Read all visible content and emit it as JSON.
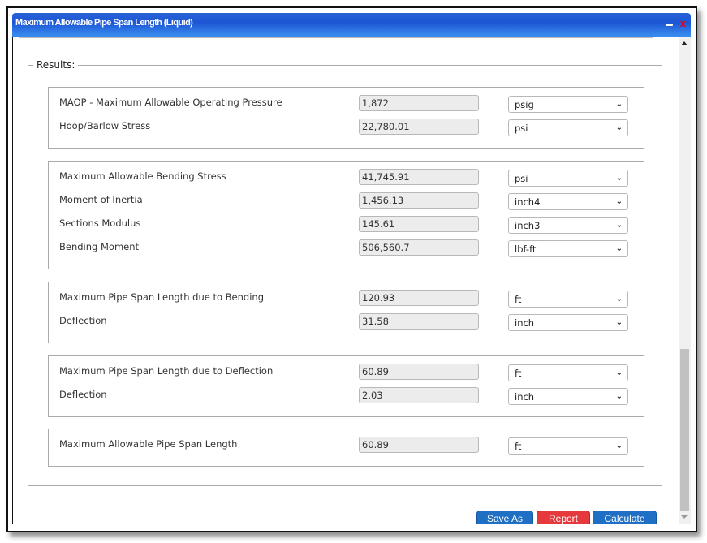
{
  "window": {
    "title": "Maximum Allowable Pipe Span Length (Liquid)",
    "minimize_icon": "minimize-icon",
    "close_icon": "close-icon",
    "close_glyph": "x"
  },
  "results": {
    "legend": "Results:",
    "groups": [
      {
        "rows": [
          {
            "label": "MAOP - Maximum Allowable Operating Pressure",
            "value": "1,872",
            "unit": "psig"
          },
          {
            "label": "Hoop/Barlow Stress",
            "value": "22,780.01",
            "unit": "psi"
          }
        ]
      },
      {
        "rows": [
          {
            "label": "Maximum Allowable Bending Stress",
            "value": "41,745.91",
            "unit": "psi"
          },
          {
            "label": "Moment of Inertia",
            "value": "1,456.13",
            "unit": "inch4"
          },
          {
            "label": "Sections Modulus",
            "value": "145.61",
            "unit": "inch3"
          },
          {
            "label": "Bending Moment",
            "value": "506,560.7",
            "unit": "lbf-ft"
          }
        ]
      },
      {
        "rows": [
          {
            "label": "Maximum Pipe Span Length due to Bending",
            "value": "120.93",
            "unit": "ft"
          },
          {
            "label": "Deflection",
            "value": "31.58",
            "unit": "inch"
          }
        ]
      },
      {
        "rows": [
          {
            "label": "Maximum Pipe Span Length due to Deflection",
            "value": "60.89",
            "unit": "ft"
          },
          {
            "label": "Deflection",
            "value": "2.03",
            "unit": "inch"
          }
        ]
      },
      {
        "rows": [
          {
            "label": "Maximum Allowable Pipe Span Length",
            "value": "60.89",
            "unit": "ft"
          }
        ]
      }
    ]
  },
  "buttons": {
    "save_as": "Save As",
    "report": "Report",
    "calculate": "Calculate"
  },
  "colors": {
    "title_bar": "#1c56d4",
    "primary_button": "#1f6fc4",
    "report_button": "#e5393c",
    "close_icon": "#e8001c"
  },
  "icons": {
    "dropdown": "chevron-down-icon",
    "chevron_glyph": "❯"
  }
}
